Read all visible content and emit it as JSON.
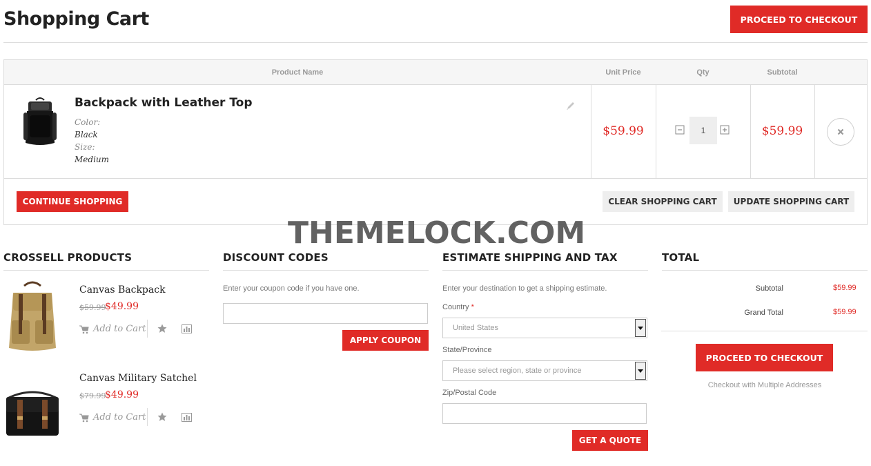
{
  "header": {
    "title": "Shopping Cart",
    "checkout_label": "Proceed to Checkout"
  },
  "cart_table": {
    "columns": [
      "Product Name",
      "Unit Price",
      "Qty",
      "Subtotal"
    ],
    "items": [
      {
        "name": "Backpack with Leather Top",
        "options": [
          {
            "label": "Color:",
            "value": "Black"
          },
          {
            "label": "Size:",
            "value": "Medium"
          }
        ],
        "unit_price": "$59.99",
        "qty": "1",
        "subtotal": "$59.99"
      }
    ],
    "actions": {
      "continue": "Continue Shopping",
      "clear": "Clear Shopping Cart",
      "update": "Update Shopping Cart"
    }
  },
  "watermark": "THEMELOCK.COM",
  "crosssell": {
    "title": "Crossell Products",
    "items": [
      {
        "name": "Canvas Backpack",
        "old_price": "$59.99",
        "price": "$49.99",
        "add_label": "Add to Cart"
      },
      {
        "name": "Canvas Military Satchel",
        "old_price": "$79.99",
        "price": "$49.99",
        "add_label": "Add to Cart"
      }
    ]
  },
  "discount": {
    "title": "Discount Codes",
    "hint": "Enter your coupon code if you have one.",
    "button": "Apply Coupon"
  },
  "shipping": {
    "title": "Estimate Shipping and Tax",
    "hint": "Enter your destination to get a shipping estimate.",
    "country_label": "Country",
    "required_mark": "*",
    "country_value": "United States",
    "state_label": "State/Province",
    "state_placeholder": "Please select region, state or province",
    "zip_label": "Zip/Postal Code",
    "button": "Get a Quote"
  },
  "totals": {
    "title": "Total",
    "subtotal_label": "Subtotal",
    "subtotal_value": "$59.99",
    "grand_label": "Grand Total",
    "grand_value": "$59.99",
    "checkout_label": "Proceed to Checkout",
    "multi_link": "Checkout with Multiple Addresses"
  },
  "colors": {
    "accent": "#e02b27",
    "button_grey": "#eeeeee",
    "border": "#dcdcdc"
  }
}
